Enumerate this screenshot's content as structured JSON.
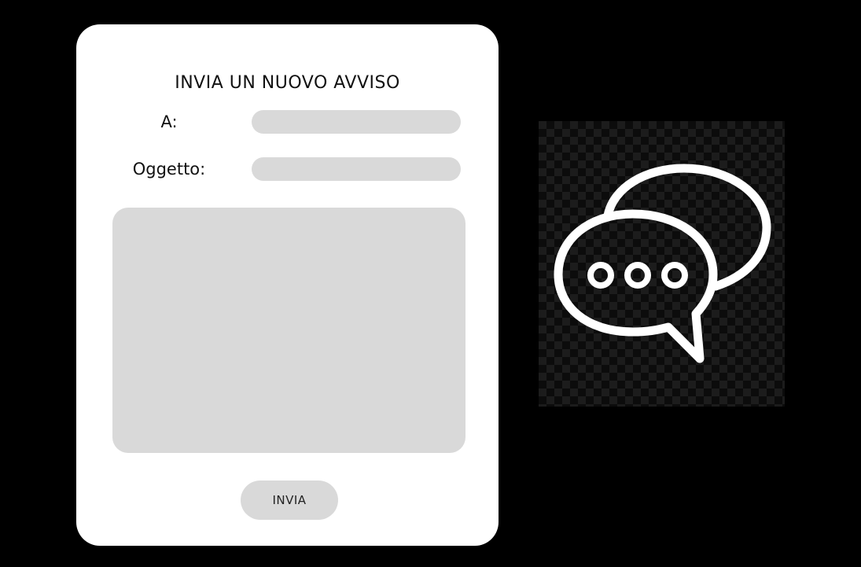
{
  "form": {
    "title": "INVIA UN NUOVO AVVISO",
    "to_label": "A:",
    "to_value": "",
    "subject_label": "Oggetto:",
    "subject_value": "",
    "message_value": "",
    "send_label": "INVIA"
  },
  "illustration": {
    "icon": "chat-bubbles-icon"
  },
  "colors": {
    "background": "#000000",
    "card": "#ffffff",
    "field": "#d9d9d9",
    "icon": "#ffffff",
    "checker_dark": "#0c0c0c",
    "checker_light": "#1c1c1c"
  }
}
